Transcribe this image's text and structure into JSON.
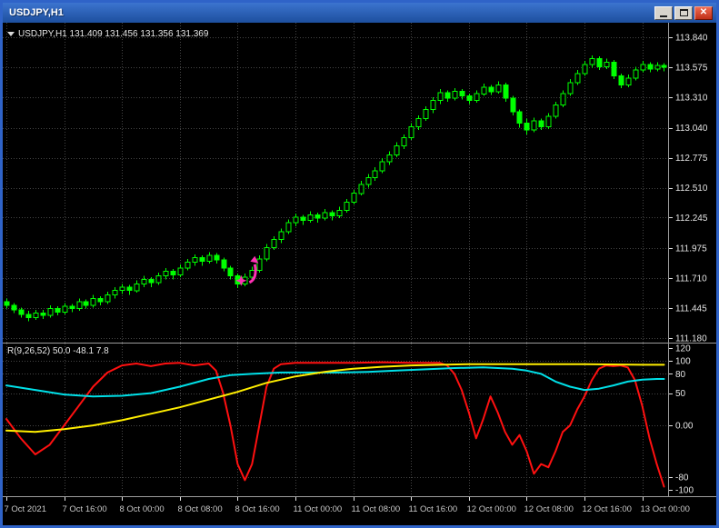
{
  "window": {
    "title": "USDJPY,H1",
    "controls": {
      "close_glyph": "✕"
    }
  },
  "chart": {
    "symbol_label": "USDJPY,H1 131.409 131.456 131.356 131.369",
    "indicator_label": "R(9,26,52) 50.0 -48.1 7.8"
  },
  "colors": {
    "background": "#000000",
    "grid": "#454545",
    "candle": "#00ff00",
    "axis_text": "#e4e4e4",
    "time_text": "#c8c8c8",
    "separator": "#9c9c9c"
  },
  "chart_data": [
    {
      "type": "candlestick",
      "symbol": "USDJPY",
      "timeframe": "H1",
      "y_axis": {
        "side": "right",
        "ticks": [
          {
            "label": "113.840",
            "value": 113.84
          },
          {
            "label": "113.575",
            "value": 113.575
          },
          {
            "label": "113.310",
            "value": 113.31
          },
          {
            "label": "113.040",
            "value": 113.04
          },
          {
            "label": "112.775",
            "value": 112.775
          },
          {
            "label": "112.510",
            "value": 112.51
          },
          {
            "label": "112.245",
            "value": 112.245
          },
          {
            "label": "111.975",
            "value": 111.975
          },
          {
            "label": "111.710",
            "value": 111.71
          },
          {
            "label": "111.445",
            "value": 111.445
          },
          {
            "label": "111.180",
            "value": 111.18
          }
        ]
      },
      "x_axis": {
        "ticks": [
          {
            "label": "7 Oct 2021",
            "bar": 0
          },
          {
            "label": "7 Oct 16:00",
            "bar": 8
          },
          {
            "label": "8 Oct 00:00",
            "bar": 16
          },
          {
            "label": "8 Oct 08:00",
            "bar": 24
          },
          {
            "label": "8 Oct 16:00",
            "bar": 32
          },
          {
            "label": "11 Oct 00:00",
            "bar": 40
          },
          {
            "label": "11 Oct 08:00",
            "bar": 48
          },
          {
            "label": "11 Oct 16:00",
            "bar": 56
          },
          {
            "label": "12 Oct 00:00",
            "bar": 64
          },
          {
            "label": "12 Oct 08:00",
            "bar": 72
          },
          {
            "label": "12 Oct 16:00",
            "bar": 80
          },
          {
            "label": "13 Oct 00:00",
            "bar": 88
          }
        ]
      },
      "candles": [
        [
          111.5,
          111.53,
          111.44,
          111.47
        ],
        [
          111.47,
          111.49,
          111.4,
          111.43
        ],
        [
          111.43,
          111.45,
          111.36,
          111.39
        ],
        [
          111.39,
          111.42,
          111.33,
          111.36
        ],
        [
          111.36,
          111.43,
          111.34,
          111.4
        ],
        [
          111.4,
          111.43,
          111.35,
          111.38
        ],
        [
          111.38,
          111.47,
          111.36,
          111.44
        ],
        [
          111.44,
          111.46,
          111.38,
          111.41
        ],
        [
          111.41,
          111.49,
          111.39,
          111.46
        ],
        [
          111.46,
          111.48,
          111.41,
          111.44
        ],
        [
          111.44,
          111.53,
          111.42,
          111.5
        ],
        [
          111.5,
          111.52,
          111.44,
          111.47
        ],
        [
          111.47,
          111.56,
          111.45,
          111.53
        ],
        [
          111.53,
          111.55,
          111.47,
          111.5
        ],
        [
          111.5,
          111.59,
          111.48,
          111.56
        ],
        [
          111.56,
          111.63,
          111.53,
          111.6
        ],
        [
          111.6,
          111.66,
          111.57,
          111.63
        ],
        [
          111.63,
          111.65,
          111.56,
          111.6
        ],
        [
          111.6,
          111.69,
          111.58,
          111.66
        ],
        [
          111.66,
          111.73,
          111.63,
          111.7
        ],
        [
          111.7,
          111.72,
          111.63,
          111.67
        ],
        [
          111.67,
          111.76,
          111.65,
          111.73
        ],
        [
          111.73,
          111.8,
          111.7,
          111.77
        ],
        [
          111.77,
          111.79,
          111.7,
          111.74
        ],
        [
          111.74,
          111.83,
          111.72,
          111.8
        ],
        [
          111.8,
          111.88,
          111.78,
          111.85
        ],
        [
          111.85,
          111.92,
          111.82,
          111.89
        ],
        [
          111.89,
          111.91,
          111.82,
          111.86
        ],
        [
          111.86,
          111.94,
          111.84,
          111.91
        ],
        [
          111.91,
          111.93,
          111.84,
          111.87
        ],
        [
          111.87,
          111.89,
          111.77,
          111.8
        ],
        [
          111.8,
          111.82,
          111.7,
          111.73
        ],
        [
          111.73,
          111.75,
          111.62,
          111.66
        ],
        [
          111.66,
          111.75,
          111.64,
          111.72
        ],
        [
          111.72,
          111.81,
          111.7,
          111.78
        ],
        [
          111.78,
          111.91,
          111.76,
          111.88
        ],
        [
          111.88,
          112.01,
          111.86,
          111.98
        ],
        [
          111.98,
          112.08,
          111.96,
          112.05
        ],
        [
          112.05,
          112.15,
          112.02,
          112.12
        ],
        [
          112.12,
          112.23,
          112.1,
          112.2
        ],
        [
          112.2,
          112.28,
          112.17,
          112.25
        ],
        [
          112.25,
          112.27,
          112.18,
          112.22
        ],
        [
          112.22,
          112.3,
          112.2,
          112.27
        ],
        [
          112.27,
          112.29,
          112.2,
          112.24
        ],
        [
          112.24,
          112.32,
          112.22,
          112.29
        ],
        [
          112.29,
          112.31,
          112.22,
          112.26
        ],
        [
          112.26,
          112.34,
          112.24,
          112.31
        ],
        [
          112.31,
          112.41,
          112.29,
          112.38
        ],
        [
          112.38,
          112.49,
          112.36,
          112.46
        ],
        [
          112.46,
          112.57,
          112.44,
          112.54
        ],
        [
          112.54,
          112.63,
          112.51,
          112.6
        ],
        [
          112.6,
          112.69,
          112.57,
          112.66
        ],
        [
          112.66,
          112.77,
          112.64,
          112.74
        ],
        [
          112.74,
          112.83,
          112.71,
          112.8
        ],
        [
          112.8,
          112.91,
          112.78,
          112.88
        ],
        [
          112.88,
          112.98,
          112.85,
          112.95
        ],
        [
          112.95,
          113.08,
          112.93,
          113.05
        ],
        [
          113.05,
          113.15,
          113.02,
          113.12
        ],
        [
          113.12,
          113.23,
          113.1,
          113.2
        ],
        [
          113.2,
          113.31,
          113.17,
          113.28
        ],
        [
          113.28,
          113.38,
          113.25,
          113.35
        ],
        [
          113.35,
          113.37,
          113.27,
          113.3
        ],
        [
          113.3,
          113.39,
          113.28,
          113.36
        ],
        [
          113.36,
          113.38,
          113.29,
          113.32
        ],
        [
          113.32,
          113.34,
          113.25,
          113.28
        ],
        [
          113.28,
          113.37,
          113.26,
          113.34
        ],
        [
          113.34,
          113.43,
          113.32,
          113.4
        ],
        [
          113.4,
          113.42,
          113.33,
          113.36
        ],
        [
          113.36,
          113.45,
          113.34,
          113.42
        ],
        [
          113.42,
          113.44,
          113.27,
          113.3
        ],
        [
          113.3,
          113.32,
          113.15,
          113.18
        ],
        [
          113.18,
          113.2,
          113.04,
          113.08
        ],
        [
          113.08,
          113.12,
          112.98,
          113.02
        ],
        [
          113.02,
          113.13,
          113.0,
          113.1
        ],
        [
          113.1,
          113.12,
          113.02,
          113.05
        ],
        [
          113.05,
          113.17,
          113.03,
          113.14
        ],
        [
          113.14,
          113.27,
          113.12,
          113.24
        ],
        [
          113.24,
          113.37,
          113.22,
          113.34
        ],
        [
          113.34,
          113.47,
          113.32,
          113.44
        ],
        [
          113.44,
          113.55,
          113.42,
          113.52
        ],
        [
          113.52,
          113.63,
          113.5,
          113.6
        ],
        [
          113.6,
          113.68,
          113.57,
          113.65
        ],
        [
          113.65,
          113.67,
          113.55,
          113.58
        ],
        [
          113.58,
          113.65,
          113.56,
          113.62
        ],
        [
          113.62,
          113.64,
          113.47,
          113.5
        ],
        [
          113.5,
          113.52,
          113.39,
          113.42
        ],
        [
          113.42,
          113.51,
          113.4,
          113.48
        ],
        [
          113.48,
          113.58,
          113.46,
          113.55
        ],
        [
          113.55,
          113.63,
          113.53,
          113.6
        ],
        [
          113.6,
          113.62,
          113.53,
          113.56
        ],
        [
          113.56,
          113.62,
          113.54,
          113.59
        ],
        [
          113.59,
          113.61,
          113.54,
          113.575
        ]
      ],
      "annotation": {
        "type": "buy-arrow",
        "bar": 33,
        "price": 111.72,
        "color": "#ff30b4"
      }
    },
    {
      "type": "line",
      "name": "R(9,26,52)",
      "current_values": "50.0 -48.1 7.8",
      "y_axis": {
        "side": "right",
        "ticks": [
          {
            "label": "120",
            "value": 120,
            "grid": false
          },
          {
            "label": "100",
            "value": 100,
            "grid": true
          },
          {
            "label": "80",
            "value": 80,
            "grid": true
          },
          {
            "label": "50",
            "value": 50,
            "grid": true
          },
          {
            "label": "0.00",
            "value": 0,
            "grid": true
          },
          {
            "label": "-80",
            "value": -80,
            "grid": true
          },
          {
            "label": "-100",
            "value": -100,
            "grid": false
          }
        ]
      },
      "series": [
        {
          "name": "R-main",
          "color": "#ff1010",
          "points": [
            [
              0,
              10
            ],
            [
              2,
              -20
            ],
            [
              4,
              -45
            ],
            [
              6,
              -30
            ],
            [
              8,
              0
            ],
            [
              10,
              30
            ],
            [
              12,
              60
            ],
            [
              14,
              82
            ],
            [
              16,
              93
            ],
            [
              18,
              96
            ],
            [
              20,
              92
            ],
            [
              22,
              96
            ],
            [
              24,
              97
            ],
            [
              26,
              93
            ],
            [
              28,
              96
            ],
            [
              29,
              85
            ],
            [
              30,
              50
            ],
            [
              31,
              0
            ],
            [
              32,
              -60
            ],
            [
              33,
              -85
            ],
            [
              34,
              -60
            ],
            [
              35,
              0
            ],
            [
              36,
              60
            ],
            [
              37,
              88
            ],
            [
              38,
              95
            ],
            [
              40,
              97
            ],
            [
              44,
              97
            ],
            [
              48,
              97
            ],
            [
              52,
              98
            ],
            [
              56,
              97
            ],
            [
              60,
              97
            ],
            [
              61,
              93
            ],
            [
              62,
              80
            ],
            [
              63,
              55
            ],
            [
              64,
              20
            ],
            [
              65,
              -20
            ],
            [
              66,
              10
            ],
            [
              67,
              45
            ],
            [
              68,
              20
            ],
            [
              69,
              -10
            ],
            [
              70,
              -30
            ],
            [
              71,
              -15
            ],
            [
              72,
              -40
            ],
            [
              73,
              -75
            ],
            [
              74,
              -60
            ],
            [
              75,
              -65
            ],
            [
              76,
              -40
            ],
            [
              77,
              -10
            ],
            [
              78,
              0
            ],
            [
              79,
              25
            ],
            [
              80,
              45
            ],
            [
              81,
              70
            ],
            [
              82,
              88
            ],
            [
              83,
              93
            ],
            [
              84,
              92
            ],
            [
              85,
              93
            ],
            [
              86,
              90
            ],
            [
              87,
              70
            ],
            [
              88,
              30
            ],
            [
              89,
              -20
            ],
            [
              90,
              -60
            ],
            [
              91,
              -95
            ]
          ]
        },
        {
          "name": "R-signal-cyan",
          "color": "#00e0e8",
          "points": [
            [
              0,
              62
            ],
            [
              4,
              55
            ],
            [
              8,
              48
            ],
            [
              12,
              45
            ],
            [
              16,
              46
            ],
            [
              20,
              50
            ],
            [
              24,
              60
            ],
            [
              28,
              72
            ],
            [
              31,
              78
            ],
            [
              34,
              80
            ],
            [
              38,
              82
            ],
            [
              42,
              82
            ],
            [
              46,
              82
            ],
            [
              50,
              83
            ],
            [
              54,
              85
            ],
            [
              58,
              87
            ],
            [
              62,
              89
            ],
            [
              66,
              90
            ],
            [
              70,
              88
            ],
            [
              72,
              85
            ],
            [
              74,
              80
            ],
            [
              76,
              68
            ],
            [
              78,
              60
            ],
            [
              80,
              55
            ],
            [
              82,
              57
            ],
            [
              84,
              62
            ],
            [
              86,
              68
            ],
            [
              88,
              71
            ],
            [
              90,
              72
            ],
            [
              91,
              72
            ]
          ]
        },
        {
          "name": "R-signal-yellow",
          "color": "#ffee00",
          "points": [
            [
              0,
              -8
            ],
            [
              4,
              -10
            ],
            [
              8,
              -6
            ],
            [
              12,
              0
            ],
            [
              16,
              8
            ],
            [
              20,
              18
            ],
            [
              24,
              28
            ],
            [
              28,
              40
            ],
            [
              32,
              52
            ],
            [
              36,
              66
            ],
            [
              40,
              76
            ],
            [
              44,
              83
            ],
            [
              48,
              88
            ],
            [
              52,
              91
            ],
            [
              56,
              93
            ],
            [
              60,
              94
            ],
            [
              64,
              95
            ],
            [
              72,
              95
            ],
            [
              80,
              95
            ],
            [
              88,
              94
            ],
            [
              91,
              94
            ]
          ]
        }
      ]
    }
  ]
}
